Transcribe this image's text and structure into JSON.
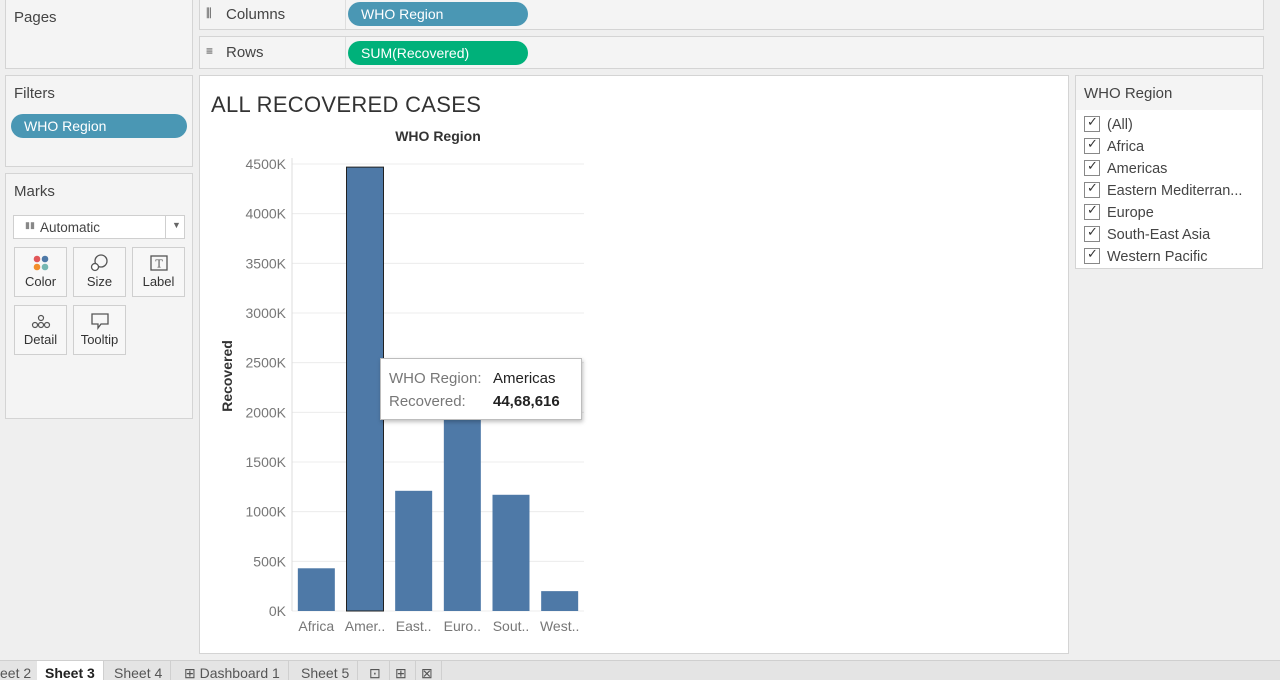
{
  "pages_panel": {
    "title": "Pages"
  },
  "columns_shelf": {
    "label": "Columns",
    "icon": "columns-icon",
    "pill": "WHO Region"
  },
  "rows_shelf": {
    "label": "Rows",
    "icon": "rows-icon",
    "pill": "SUM(Recovered)"
  },
  "filters_panel": {
    "title": "Filters",
    "pill": "WHO Region"
  },
  "marks_panel": {
    "title": "Marks",
    "mark_type": "Automatic",
    "buttons": [
      "Color",
      "Size",
      "Label",
      "Detail",
      "Tooltip"
    ]
  },
  "colors": {
    "bar": "#4e79a7",
    "pill_dimension": "#4a97b4",
    "pill_measure": "#00b17a"
  },
  "sheet": {
    "title": "ALL RECOVERED CASES"
  },
  "chart_data": {
    "type": "bar",
    "title": "WHO Region",
    "xlabel": "",
    "ylabel": "Recovered",
    "categories": [
      "Africa",
      "Amer..",
      "East..",
      "Euro..",
      "Sout..",
      "West.."
    ],
    "values": [
      430000,
      4468616,
      1210000,
      1940000,
      1170000,
      200000
    ],
    "ylim": [
      0,
      4500000
    ],
    "yticks": [
      "0K",
      "500K",
      "1000K",
      "1500K",
      "2000K",
      "2500K",
      "3000K",
      "3500K",
      "4000K",
      "4500K"
    ],
    "grid": true
  },
  "tooltip": {
    "region_key": "WHO Region:",
    "region_value": "Americas",
    "recovered_key": "Recovered:",
    "recovered_value": "44,68,616"
  },
  "region_filter": {
    "title": "WHO Region",
    "items": [
      "(All)",
      "Africa",
      "Americas",
      "Eastern Mediterran...",
      "Europe",
      "South-East Asia",
      "Western Pacific"
    ]
  },
  "tabs": [
    "eet 2",
    "Sheet 3",
    "Sheet 4",
    "Dashboard 1",
    "Sheet 5"
  ]
}
